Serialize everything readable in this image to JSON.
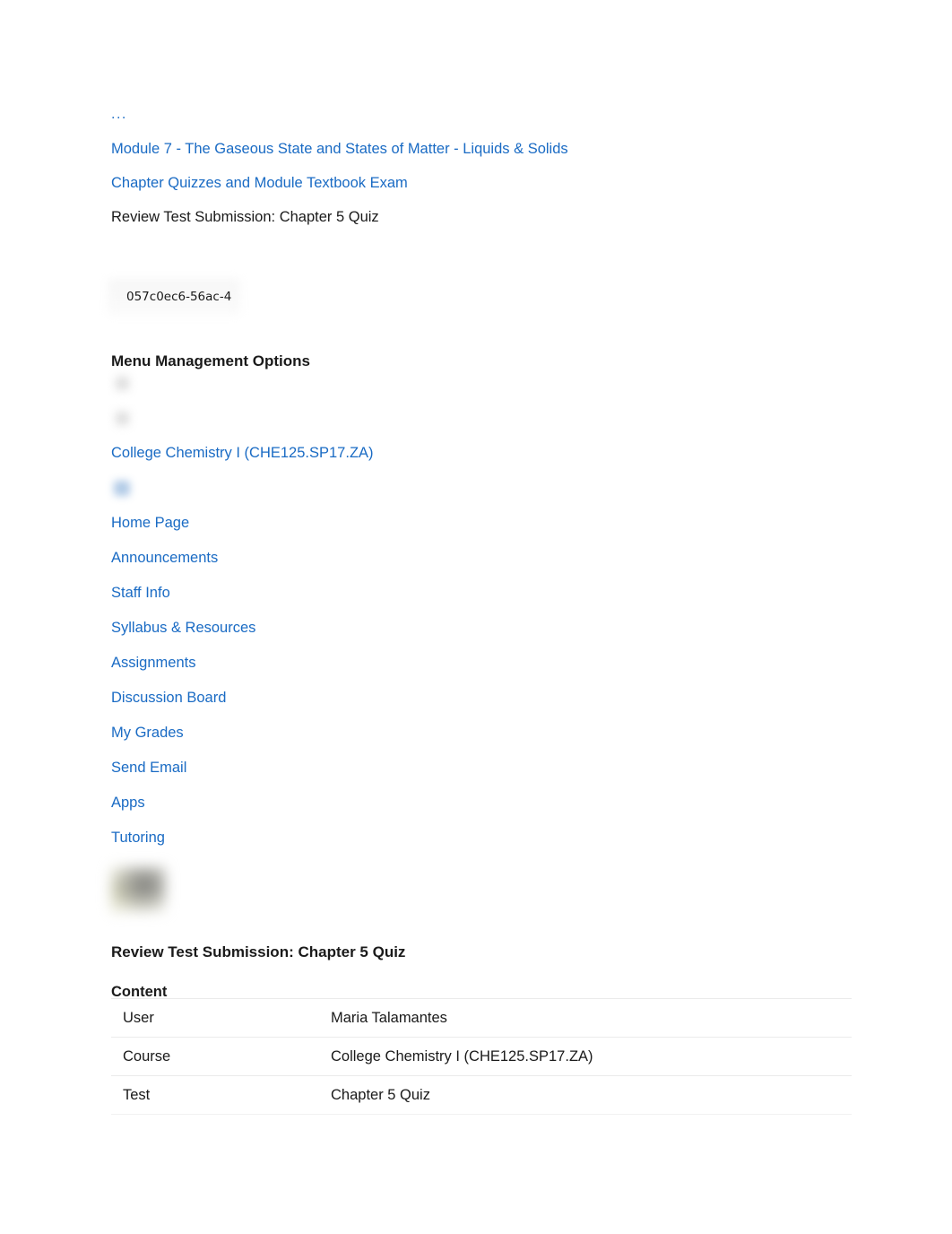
{
  "breadcrumb": {
    "ellipsis": "...",
    "items": [
      {
        "label": "Module 7 - The Gaseous State and States of Matter - Liquids & Solids",
        "type": "link"
      },
      {
        "label": "Chapter Quizzes and Module Textbook Exam",
        "type": "link"
      },
      {
        "label": "Review Test Submission: Chapter 5 Quiz",
        "type": "current"
      }
    ]
  },
  "id_chip": {
    "value": "057c0ec6-56ac-4"
  },
  "menu_management": {
    "heading": "Menu Management Options",
    "icons": [
      {
        "name": "menu-collapse-icon"
      },
      {
        "name": "menu-refresh-icon"
      }
    ]
  },
  "course_nav": {
    "course_title": "College Chemistry I (CHE125.SP17.ZA)",
    "toggle_icon": "course-menu-toggle-icon",
    "items": [
      {
        "label": "Home Page"
      },
      {
        "label": "Announcements"
      },
      {
        "label": "Staff Info"
      },
      {
        "label": "Syllabus & Resources"
      },
      {
        "label": "Assignments"
      },
      {
        "label": "Discussion Board"
      },
      {
        "label": "My Grades"
      },
      {
        "label": "Send Email"
      },
      {
        "label": "Apps"
      },
      {
        "label": "Tutoring"
      }
    ]
  },
  "banner": {
    "image_name": "course-banner-image"
  },
  "main": {
    "page_title": "Review Test Submission: Chapter 5 Quiz",
    "section_heading": "Content",
    "info_rows": [
      {
        "label": "User",
        "value": "Maria Talamantes"
      },
      {
        "label": "Course",
        "value": "College Chemistry I (CHE125.SP17.ZA)"
      },
      {
        "label": "Test",
        "value": "Chapter 5 Quiz"
      }
    ]
  },
  "colors": {
    "link": "#1a6bc4",
    "text": "#1a1a1a",
    "background": "#ffffff",
    "table_divider": "#d2d2d2"
  }
}
